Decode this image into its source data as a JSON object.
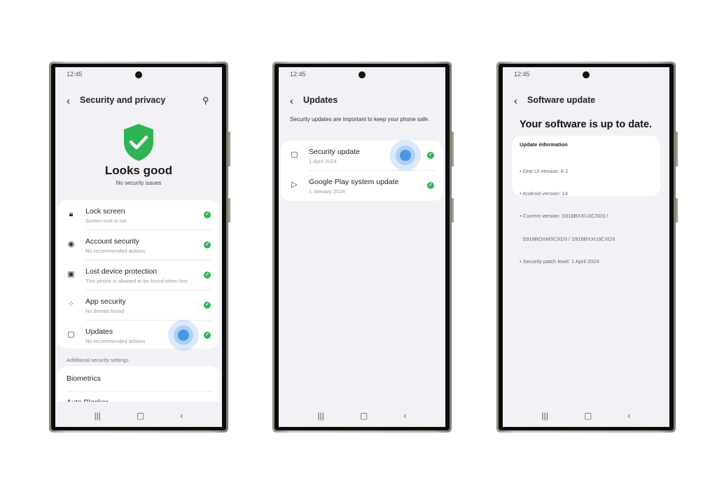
{
  "status_time": "12:45",
  "screens": [
    {
      "title": "Security and privacy",
      "hero_title": "Looks good",
      "hero_subtitle": "No security issues",
      "items": [
        {
          "icon": "lock-icon",
          "title": "Lock screen",
          "subtitle": "Screen lock is set"
        },
        {
          "icon": "account-icon",
          "title": "Account security",
          "subtitle": "No recommended actions"
        },
        {
          "icon": "lost-device-icon",
          "title": "Lost device protection",
          "subtitle": "This phone is allowed to be found when lost"
        },
        {
          "icon": "apps-icon",
          "title": "App security",
          "subtitle": "No threats found"
        },
        {
          "icon": "update-icon",
          "title": "Updates",
          "subtitle": "No recommended actions"
        }
      ],
      "section_label": "Additional security settings",
      "more_items": [
        "Biometrics",
        "Auto Blocker"
      ]
    },
    {
      "title": "Updates",
      "description": "Security updates are important to keep your phone safe.",
      "items": [
        {
          "icon": "update-icon",
          "title": "Security update",
          "subtitle": "1 April 2024"
        },
        {
          "icon": "google-play-icon",
          "title": "Google Play system update",
          "subtitle": "1 January 2024"
        }
      ]
    },
    {
      "title": "Software update",
      "headline": "Your software is up to date.",
      "info_title": "Update information",
      "info_lines": [
        "• One UI version: 6.1",
        "• Android version: 14",
        "• Current version: S918BXXU3CXD3 /",
        "  S918BOXM3CXD3 / S918BXXU3CXD3",
        "• Security patch level: 1 April 2024"
      ]
    }
  ],
  "colors": {
    "check": "#2fb454",
    "shield": "#2fb454",
    "tap": "#4a97e0"
  }
}
